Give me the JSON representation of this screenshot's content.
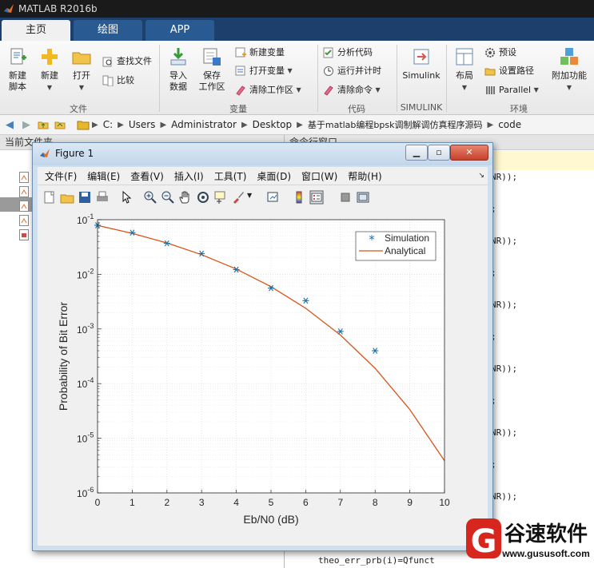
{
  "app": {
    "title": "MATLAB R2016b"
  },
  "tabs": [
    {
      "label": "主页"
    },
    {
      "label": "绘图"
    },
    {
      "label": "APP"
    }
  ],
  "ribbon": {
    "file": {
      "label": "文件",
      "new_script": "新建\n脚本",
      "new": "新建",
      "open": "打开",
      "find_files": "查找文件",
      "compare": "比较"
    },
    "variable": {
      "label": "变量",
      "import": "导入\n数据",
      "save_ws": "保存\n工作区",
      "new_var": "新建变量",
      "open_var": "打开变量",
      "clear_ws": "清除工作区"
    },
    "code": {
      "label": "代码",
      "analyze": "分析代码",
      "run_time": "运行并计时",
      "clear_cmd": "清除命令"
    },
    "simulink": {
      "label": "SIMULINK",
      "simulink": "Simulink"
    },
    "env": {
      "label": "环境",
      "layout": "布局",
      "prefs": "预设",
      "set_path": "设置路径",
      "parallel": "Parallel",
      "addons": "附加功能"
    }
  },
  "address": {
    "crumbs": [
      "C:",
      "Users",
      "Administrator",
      "Desktop",
      "基于matlab编程bpsk调制解调仿真程序源码",
      "code"
    ]
  },
  "left_panel": {
    "title": "当前文件夹"
  },
  "cmd_panel": {
    "title": "命令行窗口",
    "fragments": [
      "NR));",
      ";",
      "NR));",
      ";",
      "NR));",
      ";",
      "NR));",
      ";",
      "NR));",
      ";",
      "NR));"
    ],
    "last_line": "theo_err_prb(i)=Qfunct"
  },
  "figure": {
    "title": "Figure 1",
    "menu": [
      "文件(F)",
      "编辑(E)",
      "查看(V)",
      "插入(I)",
      "工具(T)",
      "桌面(D)",
      "窗口(W)",
      "帮助(H)"
    ],
    "toolbar": [
      "new-figure-icon",
      "open-file-icon",
      "save-icon",
      "print-icon",
      "arrow-pointer-icon",
      "zoom-in-icon",
      "zoom-out-icon",
      "pan-hand-icon",
      "rotate-3d-icon",
      "data-cursor-icon",
      "brush-icon",
      "link-plot-icon",
      "colorbar-icon",
      "legend-icon",
      "hide-plot-tools-icon",
      "show-plot-tools-icon"
    ]
  },
  "chart_data": {
    "type": "line",
    "xlabel": "Eb/N0 (dB)",
    "ylabel": "Probability of Bit Error",
    "xlim": [
      0,
      10
    ],
    "ylim": [
      1e-06,
      0.1
    ],
    "yscale": "log",
    "grid": true,
    "legend_position": "top-right",
    "xticks": [
      0,
      1,
      2,
      3,
      4,
      5,
      6,
      7,
      8,
      9,
      10
    ],
    "yticks": [
      {
        "value": 1e-06,
        "exp": "-6"
      },
      {
        "value": 1e-05,
        "exp": "-5"
      },
      {
        "value": 0.0001,
        "exp": "-4"
      },
      {
        "value": 0.001,
        "exp": "-3"
      },
      {
        "value": 0.01,
        "exp": "-2"
      },
      {
        "value": 0.1,
        "exp": "-1"
      }
    ],
    "y_tick_base": "10",
    "series": [
      {
        "name": "Simulation",
        "style": "markers",
        "color": "#1f6f9f",
        "x": [
          0,
          1,
          2,
          3,
          4,
          5,
          6,
          7,
          8
        ],
        "y": [
          0.079,
          0.058,
          0.037,
          0.024,
          0.0122,
          0.0056,
          0.0033,
          0.0009,
          0.0004
        ]
      },
      {
        "name": "Analytical",
        "style": "line",
        "color": "#d95319",
        "x": [
          0,
          1,
          2,
          3,
          4,
          5,
          6,
          7,
          8,
          9,
          10
        ],
        "y": [
          0.0786,
          0.0563,
          0.0375,
          0.0229,
          0.0125,
          0.00595,
          0.00239,
          0.000773,
          0.000191,
          3.36e-05,
          3.87e-06
        ]
      }
    ]
  },
  "watermark": {
    "brand": "谷速软件",
    "url": "www.gususoft.com"
  },
  "colors": {
    "tabstrip": "#1c3f6b",
    "analytical": "#d95319",
    "simulation": "#1f6f9f"
  }
}
